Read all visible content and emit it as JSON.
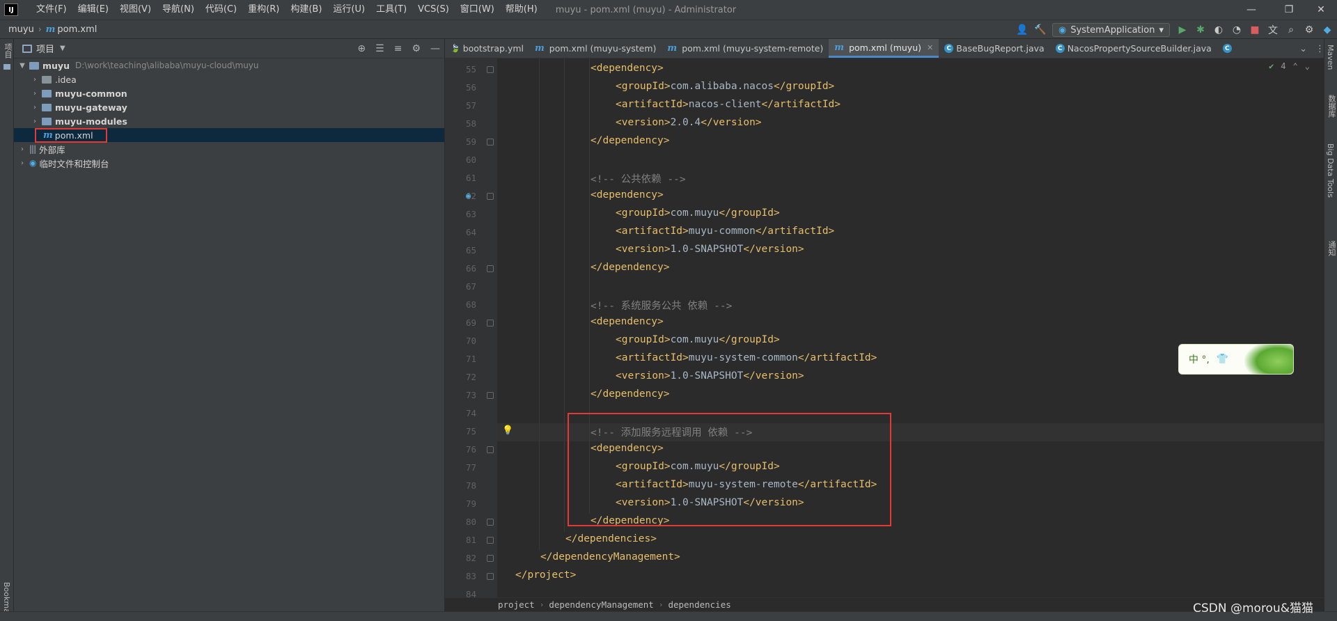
{
  "app": {
    "logo": "IJ",
    "window_title": "muyu - pom.xml (muyu) - Administrator",
    "menu": [
      "文件(F)",
      "编辑(E)",
      "视图(V)",
      "导航(N)",
      "代码(C)",
      "重构(R)",
      "构建(B)",
      "运行(U)",
      "工具(T)",
      "VCS(S)",
      "窗口(W)",
      "帮助(H)"
    ],
    "window_controls": {
      "minimize": "—",
      "restore": "❐",
      "close": "✕"
    }
  },
  "navbar": {
    "project": "muyu",
    "file": "pom.xml",
    "run_config": "SystemApplication"
  },
  "left_stripe": {
    "project_label": "项目",
    "bookmarks_label": "Bookmarks"
  },
  "right_stripe": {
    "labels": [
      "Maven",
      "数据库",
      "Big Data Tools",
      "通知"
    ]
  },
  "project_panel": {
    "title": "项目",
    "root": {
      "name": "muyu",
      "path": "D:\\work\\teaching\\alibaba\\muyu-cloud\\muyu"
    },
    "items": [
      {
        "name": ".idea"
      },
      {
        "name": "muyu-common"
      },
      {
        "name": "muyu-gateway"
      },
      {
        "name": "muyu-modules"
      },
      {
        "name": "pom.xml"
      },
      {
        "name": "外部库"
      },
      {
        "name": "临时文件和控制台"
      }
    ]
  },
  "tabs": [
    {
      "label": "bootstrap.yml",
      "icon": "yml-icon",
      "active": false
    },
    {
      "label": "pom.xml (muyu-system)",
      "icon": "maven-icon",
      "active": false
    },
    {
      "label": "pom.xml (muyu-system-remote)",
      "icon": "maven-icon",
      "active": false
    },
    {
      "label": "pom.xml (muyu)",
      "icon": "maven-icon",
      "active": true
    },
    {
      "label": "BaseBugReport.java",
      "icon": "class-icon",
      "active": false
    },
    {
      "label": "NacosPropertySourceBuilder.java",
      "icon": "class-icon",
      "active": false
    }
  ],
  "editor": {
    "inspection_count": "4",
    "lines": [
      {
        "n": 55,
        "indent": 3,
        "parts": [
          [
            "tag",
            "<dependency>"
          ]
        ]
      },
      {
        "n": 56,
        "indent": 4,
        "parts": [
          [
            "tag",
            "<groupId>"
          ],
          [
            "txt",
            "com.alibaba.nacos"
          ],
          [
            "tag",
            "</groupId>"
          ]
        ]
      },
      {
        "n": 57,
        "indent": 4,
        "parts": [
          [
            "tag",
            "<artifactId>"
          ],
          [
            "txt",
            "nacos-client"
          ],
          [
            "tag",
            "</artifactId>"
          ]
        ]
      },
      {
        "n": 58,
        "indent": 4,
        "parts": [
          [
            "tag",
            "<version>"
          ],
          [
            "txt",
            "2.0.4"
          ],
          [
            "tag",
            "</version>"
          ]
        ]
      },
      {
        "n": 59,
        "indent": 3,
        "parts": [
          [
            "tag",
            "</dependency>"
          ]
        ]
      },
      {
        "n": 60,
        "indent": 0,
        "parts": []
      },
      {
        "n": 61,
        "indent": 3,
        "parts": [
          [
            "cmt",
            "<!-- 公共依赖 -->"
          ]
        ]
      },
      {
        "n": 62,
        "indent": 3,
        "parts": [
          [
            "tag",
            "<dependency>"
          ]
        ]
      },
      {
        "n": 63,
        "indent": 4,
        "parts": [
          [
            "tag",
            "<groupId>"
          ],
          [
            "txt",
            "com.muyu"
          ],
          [
            "tag",
            "</groupId>"
          ]
        ]
      },
      {
        "n": 64,
        "indent": 4,
        "parts": [
          [
            "tag",
            "<artifactId>"
          ],
          [
            "txt",
            "muyu-common"
          ],
          [
            "tag",
            "</artifactId>"
          ]
        ]
      },
      {
        "n": 65,
        "indent": 4,
        "parts": [
          [
            "tag",
            "<version>"
          ],
          [
            "txt",
            "1.0-SNAPSHOT"
          ],
          [
            "tag",
            "</version>"
          ]
        ]
      },
      {
        "n": 66,
        "indent": 3,
        "parts": [
          [
            "tag",
            "</dependency>"
          ]
        ]
      },
      {
        "n": 67,
        "indent": 0,
        "parts": []
      },
      {
        "n": 68,
        "indent": 3,
        "parts": [
          [
            "cmt",
            "<!-- 系统服务公共 依赖 -->"
          ]
        ]
      },
      {
        "n": 69,
        "indent": 3,
        "parts": [
          [
            "tag",
            "<dependency>"
          ]
        ]
      },
      {
        "n": 70,
        "indent": 4,
        "parts": [
          [
            "tag",
            "<groupId>"
          ],
          [
            "txt",
            "com.muyu"
          ],
          [
            "tag",
            "</groupId>"
          ]
        ]
      },
      {
        "n": 71,
        "indent": 4,
        "parts": [
          [
            "tag",
            "<artifactId>"
          ],
          [
            "txt",
            "muyu-system-common"
          ],
          [
            "tag",
            "</artifactId>"
          ]
        ]
      },
      {
        "n": 72,
        "indent": 4,
        "parts": [
          [
            "tag",
            "<version>"
          ],
          [
            "txt",
            "1.0-SNAPSHOT"
          ],
          [
            "tag",
            "</version>"
          ]
        ]
      },
      {
        "n": 73,
        "indent": 3,
        "parts": [
          [
            "tag",
            "</dependency>"
          ]
        ]
      },
      {
        "n": 74,
        "indent": 0,
        "parts": []
      },
      {
        "n": 75,
        "indent": 3,
        "parts": [
          [
            "cmt",
            "<!-- 添加服务远程调用 依赖 -->"
          ]
        ]
      },
      {
        "n": 76,
        "indent": 3,
        "parts": [
          [
            "tag",
            "<dependency>"
          ]
        ]
      },
      {
        "n": 77,
        "indent": 4,
        "parts": [
          [
            "tag",
            "<groupId>"
          ],
          [
            "txt",
            "com.muyu"
          ],
          [
            "tag",
            "</groupId>"
          ]
        ]
      },
      {
        "n": 78,
        "indent": 4,
        "parts": [
          [
            "tag",
            "<artifactId>"
          ],
          [
            "txt",
            "muyu-system-remote"
          ],
          [
            "tag",
            "</artifactId>"
          ]
        ]
      },
      {
        "n": 79,
        "indent": 4,
        "parts": [
          [
            "tag",
            "<version>"
          ],
          [
            "txt",
            "1.0-SNAPSHOT"
          ],
          [
            "tag",
            "</version>"
          ]
        ]
      },
      {
        "n": 80,
        "indent": 3,
        "parts": [
          [
            "tag",
            "</dependency>"
          ]
        ]
      },
      {
        "n": 81,
        "indent": 2,
        "parts": [
          [
            "tag",
            "</dependencies>"
          ]
        ]
      },
      {
        "n": 82,
        "indent": 1,
        "parts": [
          [
            "tag",
            "</dependencyManagement>"
          ]
        ]
      },
      {
        "n": 83,
        "indent": 0,
        "parts": [
          [
            "tag",
            "</project>"
          ]
        ]
      },
      {
        "n": 84,
        "indent": 0,
        "parts": []
      }
    ]
  },
  "breadcrumbs": [
    "project",
    "dependencyManagement",
    "dependencies"
  ],
  "ime": {
    "text": "中 °,"
  },
  "watermark": "CSDN @morou&猫猫",
  "colors": {
    "accent": "#4a88c7",
    "highlight_box": "#e53935",
    "tag": "#e8bf6a",
    "comment": "#808080"
  }
}
